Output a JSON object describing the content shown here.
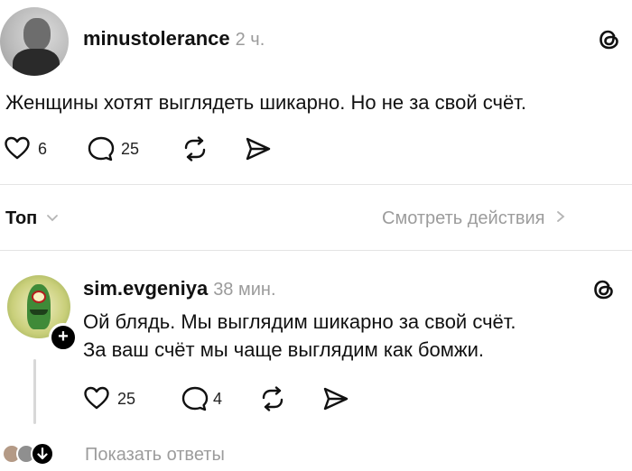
{
  "post": {
    "username": "minustolerance",
    "time": "2 ч.",
    "text": "Женщины хотят выглядеть шикарно. Но не за свой счёт.",
    "likes": "6",
    "comments": "25",
    "icons": [
      "heart-icon",
      "comment-icon",
      "repost-icon",
      "share-icon",
      "threads-logo-icon"
    ]
  },
  "sort": {
    "label": "Топ",
    "view_activity": "Смотреть действия"
  },
  "reply": {
    "username": "sim.evgeniya",
    "time": "38 мин.",
    "line1": "Ой блядь. Мы выглядим шикарно за свой счёт.",
    "line2": "За ваш счёт мы чаще выглядим как бомжи.",
    "likes": "25",
    "comments": "4",
    "show_replies": "Показать ответы"
  },
  "colors": {
    "text": "#111111",
    "muted": "#9b9b9b",
    "divider": "#e4e4e4"
  }
}
